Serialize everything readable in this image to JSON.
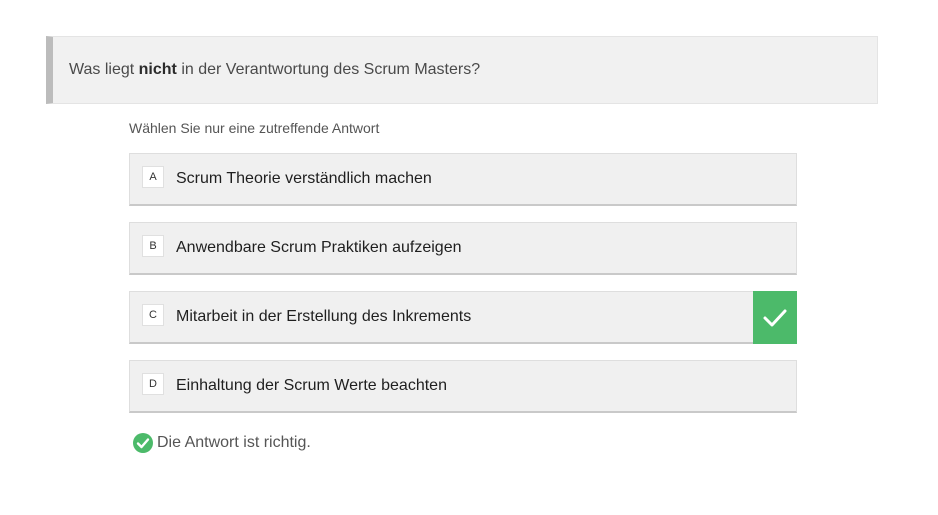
{
  "question": {
    "prefix": "Was liegt ",
    "emphasis": "nicht",
    "suffix": " in der Verantwortung des Scrum Masters?"
  },
  "instruction": "Wählen Sie nur eine zutreffende Antwort",
  "answers": [
    {
      "letter": "A",
      "text": "Scrum Theorie verständlich machen",
      "selected": false
    },
    {
      "letter": "B",
      "text": "Anwendbare Scrum Praktiken aufzeigen",
      "selected": false
    },
    {
      "letter": "C",
      "text": "Mitarbeit in der Erstellung des Inkrements",
      "selected": true
    },
    {
      "letter": "D",
      "text": "Einhaltung der Scrum Werte beachten",
      "selected": false
    }
  ],
  "feedback": {
    "text": "Die Antwort ist richtig.",
    "icon": "check-circle-icon"
  },
  "colors": {
    "correct": "#4cba6a",
    "question_bg": "#f1f1f1",
    "question_accent": "#bcbcbc"
  }
}
